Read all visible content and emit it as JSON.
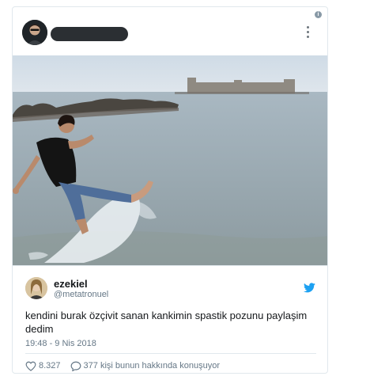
{
  "tweet": {
    "user_name": "ezekiel",
    "user_handle": "@metatronuel",
    "text": "kendini burak özçivit sanan kankimin spastik pozunu paylaşim dedim",
    "timestamp": "19:48 - 9 Nis 2018",
    "likes": "8.327",
    "replies_text": "377 kişi bunun hakkında konuşuyor"
  },
  "icons": {
    "info": "info-icon",
    "more": "more-vertical-icon",
    "bird": "twitter-bird-icon",
    "like": "heart-icon",
    "reply": "speech-bubble-icon"
  },
  "colors": {
    "twitter_blue": "#1da1f2",
    "secondary_text": "#657786",
    "border": "#e1e8ed"
  }
}
